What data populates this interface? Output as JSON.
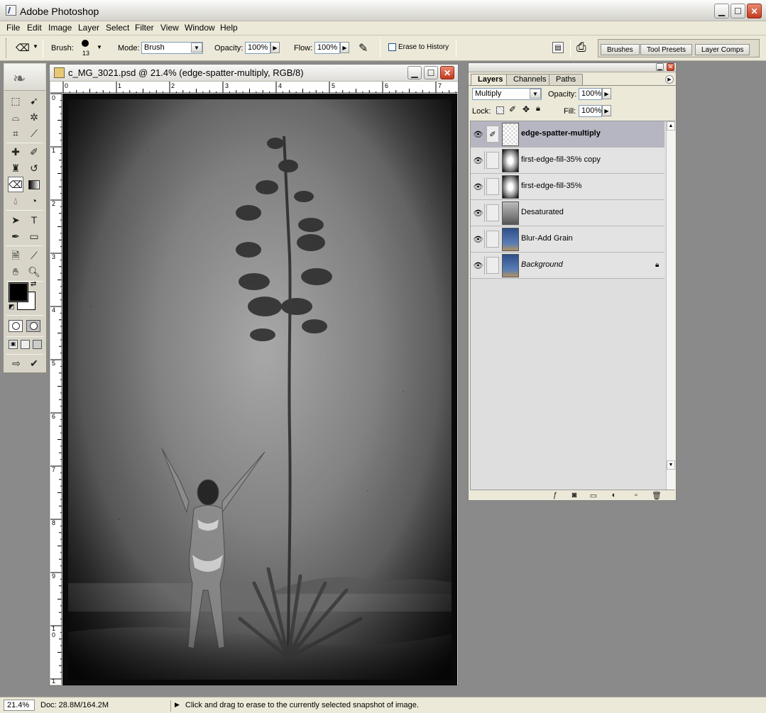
{
  "app": {
    "title": "Adobe Photoshop"
  },
  "menu": [
    "File",
    "Edit",
    "Image",
    "Layer",
    "Select",
    "Filter",
    "View",
    "Window",
    "Help"
  ],
  "options": {
    "brush_label": "Brush:",
    "brush_size": "13",
    "mode_label": "Mode:",
    "mode_value": "Brush",
    "opacity_label": "Opacity:",
    "opacity_value": "100%",
    "flow_label": "Flow:",
    "flow_value": "100%",
    "erase_history_label": "Erase to History",
    "erase_history_checked": false,
    "well_tabs": [
      "Brushes",
      "Tool Presets",
      "Layer Comps"
    ]
  },
  "document": {
    "title": "c_MG_3021.psd @ 21.4% (edge-spatter-multiply, RGB/8)",
    "ruler_top": [
      "0",
      "1",
      "2",
      "3",
      "4",
      "5",
      "6",
      "7"
    ],
    "ruler_left": [
      "0",
      "1",
      "2",
      "3",
      "4",
      "5",
      "6",
      "7",
      "8",
      "9",
      "1\n0",
      "1"
    ]
  },
  "layers_panel": {
    "tabs": [
      "Layers",
      "Channels",
      "Paths"
    ],
    "active_tab": "Layers",
    "blend_mode": "Multiply",
    "opacity_label": "Opacity:",
    "opacity_value": "100%",
    "lock_label": "Lock:",
    "fill_label": "Fill:",
    "fill_value": "100%",
    "layers": [
      {
        "name": "edge-spatter-multiply",
        "selected": true,
        "thumb": "transparent",
        "bold": true
      },
      {
        "name": "first-edge-fill-35% copy",
        "selected": false,
        "thumb": "radial"
      },
      {
        "name": "first-edge-fill-35%",
        "selected": false,
        "thumb": "radial"
      },
      {
        "name": "Desaturated",
        "selected": false,
        "thumb": "gray-photo"
      },
      {
        "name": "Blur-Add Grain",
        "selected": false,
        "thumb": "color-photo"
      },
      {
        "name": "Background",
        "selected": false,
        "thumb": "color-photo",
        "italic": true,
        "locked": true
      }
    ]
  },
  "status": {
    "zoom": "21.4%",
    "doc": "Doc: 28.8M/164.2M",
    "message": "Click and drag to erase to the currently selected snapshot of image."
  },
  "colors": {
    "window_bg": "#8a8a8a",
    "chrome": "#ece9d8",
    "selected_layer": "#b5b6c1",
    "close_red": "#c3381c"
  }
}
